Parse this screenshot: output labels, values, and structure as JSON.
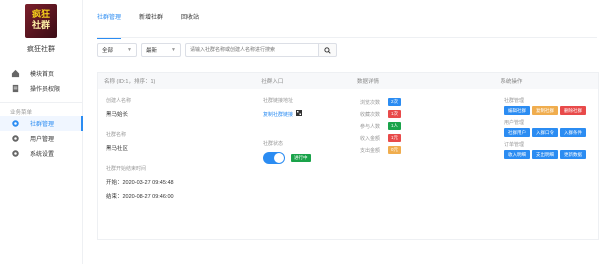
{
  "sidebar": {
    "logo_line1": "疯狂",
    "logo_line2": "社群",
    "app_name": "疯狂社群",
    "items_top": [
      {
        "label": "模块首页",
        "icon": "home-icon"
      },
      {
        "label": "操作员权限",
        "icon": "document-icon"
      }
    ],
    "group_label": "业务菜单",
    "items_business": [
      {
        "label": "社群管理",
        "icon": "gear-icon",
        "active": true
      },
      {
        "label": "用户管理",
        "icon": "gear-icon"
      },
      {
        "label": "系统设置",
        "icon": "gear-icon"
      }
    ]
  },
  "tabs": [
    {
      "label": "社群管理",
      "active": true
    },
    {
      "label": "新增社群",
      "active": false
    },
    {
      "label": "回收站",
      "active": false
    }
  ],
  "filters": {
    "status_select": "全部",
    "sort_select": "最新",
    "search_placeholder": "请输入社群名称或创建人名称进行搜索"
  },
  "table": {
    "headers": [
      "名称 (ID:1，排序：1)",
      "社群入口",
      "数据详情",
      "",
      "系统操作"
    ],
    "row": {
      "creator_label": "创建人名称",
      "creator_value": "黑马始长",
      "community_label": "社群名称",
      "community_value": "黑马社区",
      "time_label": "社群开始结束时间",
      "start_text": "开始：2020-03-27 09:45:48",
      "end_text": "结束：2020-08-27 09:46:00",
      "link_label": "社群链接地址",
      "link_text": "复制社群链接",
      "status_label": "社群状态",
      "status_badge": "进行中",
      "stats": [
        {
          "key": "浏览次数",
          "value": "2次",
          "color": "#2b8cf2"
        },
        {
          "key": "收藏次数",
          "value": "1次",
          "color": "#e84a4a"
        },
        {
          "key": "参与人数",
          "value": "1人",
          "color": "#1aa34a"
        },
        {
          "key": "收入金额",
          "value": "1元",
          "color": "#e84a4a"
        },
        {
          "key": "支出金额",
          "value": "0元",
          "color": "#f0ad4e"
        }
      ],
      "ops": [
        {
          "title": "社群管理",
          "buttons": [
            {
              "label": "编辑社群",
              "color": "#2b8cf2"
            },
            {
              "label": "复制社群",
              "color": "#f0ad4e"
            },
            {
              "label": "删除社群",
              "color": "#e84a4a"
            }
          ]
        },
        {
          "title": "用户管理",
          "buttons": [
            {
              "label": "社群用户",
              "color": "#2b8cf2"
            },
            {
              "label": "入群口令",
              "color": "#2b8cf2"
            },
            {
              "label": "入群条件",
              "color": "#2b8cf2"
            }
          ]
        },
        {
          "title": "订单管理",
          "buttons": [
            {
              "label": "收入明细",
              "color": "#2b8cf2"
            },
            {
              "label": "支出明细",
              "color": "#2b8cf2"
            },
            {
              "label": "更新数据",
              "color": "#2b8cf2"
            }
          ]
        }
      ]
    }
  }
}
